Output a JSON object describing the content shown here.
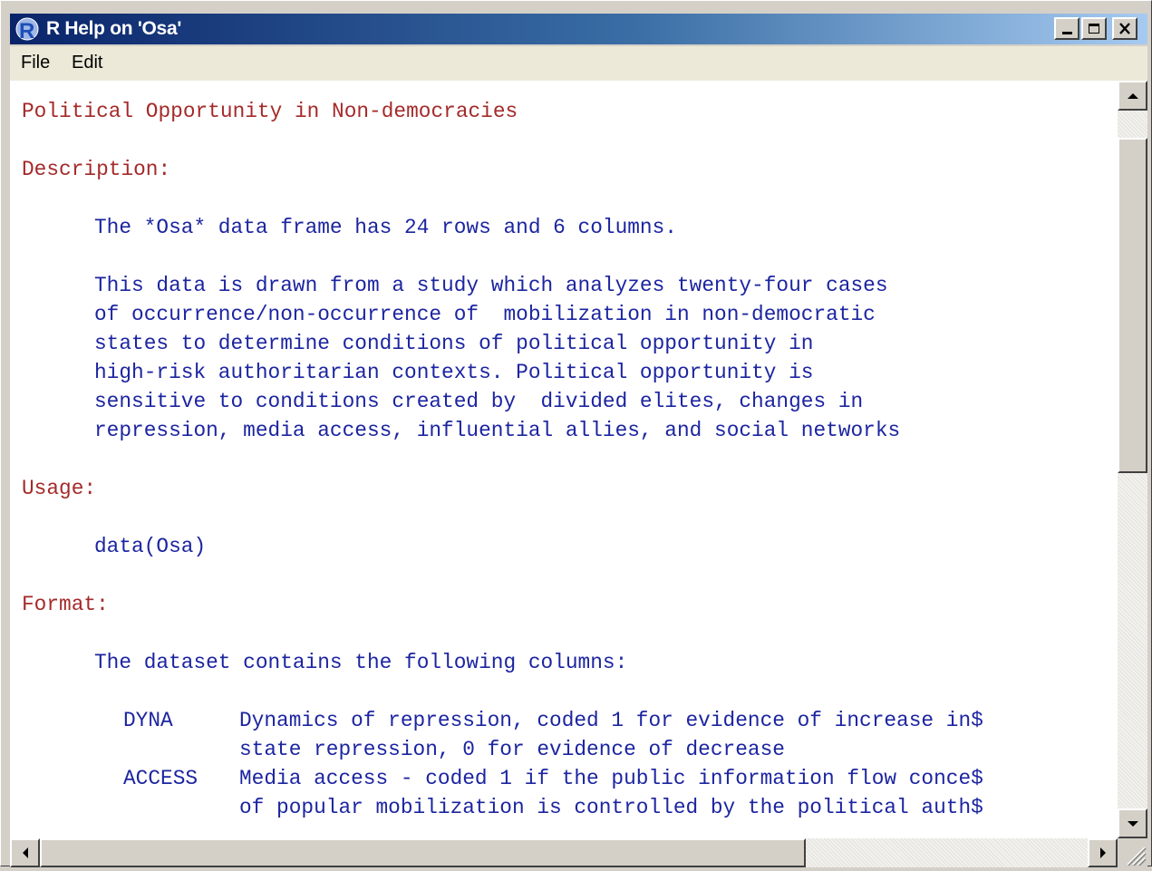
{
  "window": {
    "title": "R Help on 'Osa'",
    "app_icon": "R"
  },
  "menu": {
    "file_label": "File",
    "edit_label": "Edit"
  },
  "content": {
    "title": "Political Opportunity in Non-democracies",
    "description_heading": "Description:",
    "description_lines": [
      "The *Osa* data frame has 24 rows and 6 columns.",
      "This data is drawn from a study which analyzes twenty-four cases",
      "of occurrence/non-occurrence of  mobilization in non-democratic",
      "states to determine conditions of political opportunity in",
      "high-risk authoritarian contexts. Political opportunity is",
      "sensitive to conditions created by  divided elites, changes in",
      "repression, media access, influential allies, and social networks"
    ],
    "usage_heading": "Usage:",
    "usage_code": "data(Osa)",
    "format_heading": "Format:",
    "format_intro": "The dataset contains the following columns:",
    "columns": [
      {
        "name": "DYNA",
        "lines": [
          "Dynamics of repression, coded 1 for evidence of increase in$",
          "state repression, 0 for evidence of decrease"
        ]
      },
      {
        "name": "ACCESS",
        "lines": [
          "Media access - coded 1 if the public information flow conce$",
          "of popular mobilization is controlled by the political auth$"
        ]
      }
    ]
  },
  "colors": {
    "heading": "#a52a2a",
    "body_text": "#1c25a0",
    "titlebar_start": "#0a246a",
    "titlebar_end": "#a6caf0"
  }
}
